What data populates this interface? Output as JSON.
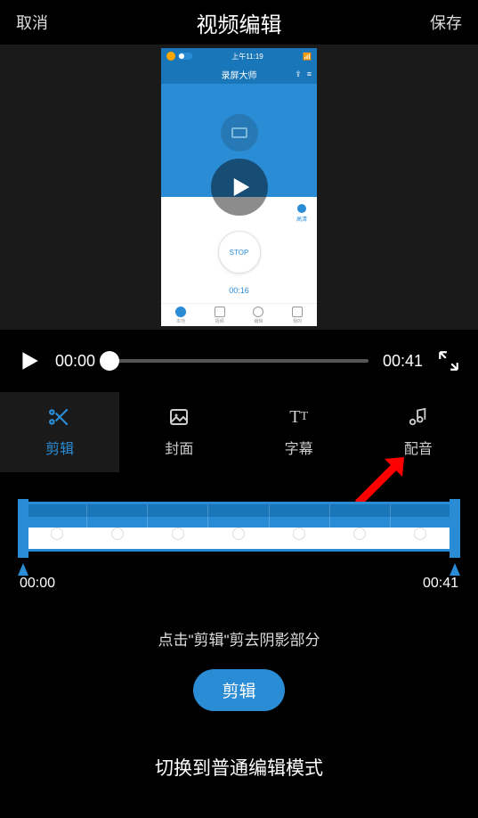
{
  "header": {
    "cancel": "取消",
    "title": "视频编辑",
    "save": "保存"
  },
  "phonePreview": {
    "statusTime": "上午11:19",
    "appTitle": "录屏大师",
    "stopLabel": "STOP",
    "recTime": "00:16"
  },
  "player": {
    "currentTime": "00:00",
    "duration": "00:41"
  },
  "tabs": {
    "trim": "剪辑",
    "cover": "封面",
    "subtitle": "字幕",
    "dub": "配音"
  },
  "timeline": {
    "start": "00:00",
    "end": "00:41"
  },
  "hint": "点击\"剪辑\"剪去阴影部分",
  "trimButton": "剪辑",
  "modeSwitch": "切换到普通编辑模式",
  "colors": {
    "accent": "#2b8cd6",
    "previewBlue": "#1976b8"
  }
}
